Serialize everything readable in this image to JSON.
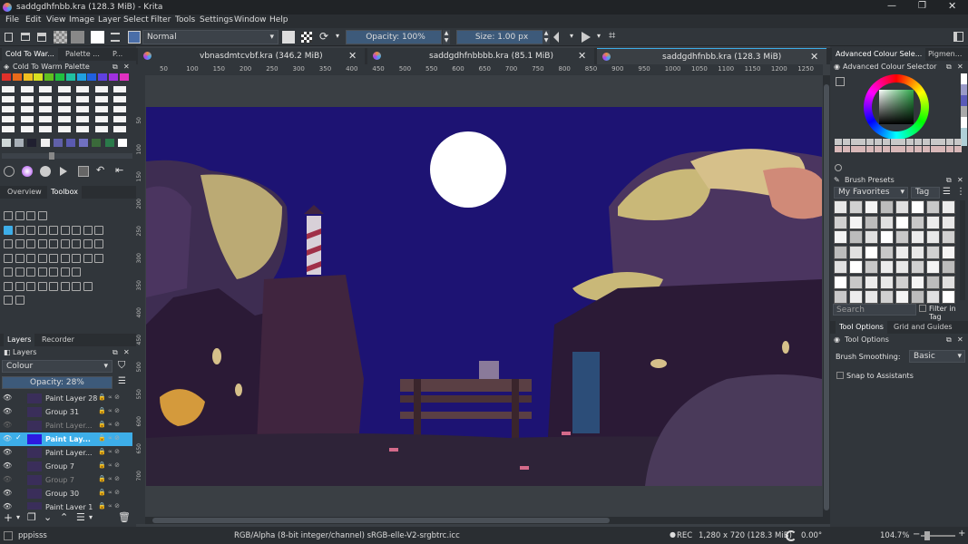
{
  "window": {
    "title": "saddgdhfnbb.kra (128.3 MiB) - Krita"
  },
  "menu": [
    "File",
    "Edit",
    "View",
    "Image",
    "Layer",
    "Select",
    "Filter",
    "Tools",
    "Settings",
    "Window",
    "Help"
  ],
  "toolbar": {
    "blend_mode": "Normal",
    "opacity": "Opacity: 100%",
    "size": "Size: 1.00 px"
  },
  "doc_tabs": [
    {
      "label": "vbnasdmtcvbf.kra (346.2 MiB)"
    },
    {
      "label": "saddgdhfnbbbb.kra (85.1 MiB)"
    },
    {
      "label": "saddgdhfnbb.kra (128.3 MiB)"
    }
  ],
  "ruler_labels": [
    "50",
    "100",
    "150",
    "200",
    "250",
    "300",
    "350",
    "400",
    "450",
    "500",
    "550",
    "600",
    "650",
    "700",
    "750",
    "800",
    "850",
    "900",
    "950",
    "1000",
    "1050",
    "1100",
    "1150",
    "1200",
    "1250"
  ],
  "vruler_labels": [
    "50",
    "100",
    "150",
    "200",
    "250",
    "300",
    "350",
    "400",
    "450",
    "500",
    "550",
    "600",
    "650",
    "700"
  ],
  "left": {
    "palette_tabs": [
      "Cold To War...",
      "Palette ...",
      "P..."
    ],
    "palette_title": "Cold To Warm Palette",
    "tabs2": [
      "Overview",
      "Toolbox"
    ],
    "tabs3": [
      "Layers",
      "Recorder"
    ],
    "layers_title": "Layers",
    "blend": "Colour",
    "opacity": "Opacity:  28%",
    "layers": [
      {
        "name": "Paint Layer 28",
        "visible": true
      },
      {
        "name": "Group 31",
        "visible": true
      },
      {
        "name": "Paint Layer...",
        "visible": false
      },
      {
        "name": "Paint Lay...",
        "visible": true,
        "selected": true
      },
      {
        "name": "Paint Layer...",
        "visible": true
      },
      {
        "name": "Group 7",
        "visible": true
      },
      {
        "name": "Group 7",
        "visible": false
      },
      {
        "name": "Group 30",
        "visible": true
      },
      {
        "name": "Paint Layer 1",
        "visible": true
      }
    ]
  },
  "right": {
    "tabs": [
      "Advanced Colour Sele...",
      "Pigmen..."
    ],
    "acs_title": "Advanced Colour Selector",
    "presets_title": "Brush Presets",
    "favorites": "My Favorites",
    "tag": "Tag",
    "search_placeholder": "Search",
    "filter_in_tag": "Filter in Tag",
    "tabs2": [
      "Tool Options",
      "Grid and Guides"
    ],
    "tool_options_title": "Tool Options",
    "smoothing_label": "Brush Smoothing:",
    "smoothing_value": "Basic",
    "snap_label": "Snap to Assistants"
  },
  "status": {
    "brush": "pppisss",
    "colorspace": "RGB/Alpha (8-bit integer/channel)  sRGB-elle-V2-srgbtrc.icc",
    "rec": "REC",
    "dims": "1,280 x 720 (128.3 MiB)",
    "rotation": "0.00°",
    "zoom": "104.7%"
  },
  "colors": {
    "accent": "#3daee9",
    "sky": "#1d1373",
    "moon": "#ffffff"
  }
}
